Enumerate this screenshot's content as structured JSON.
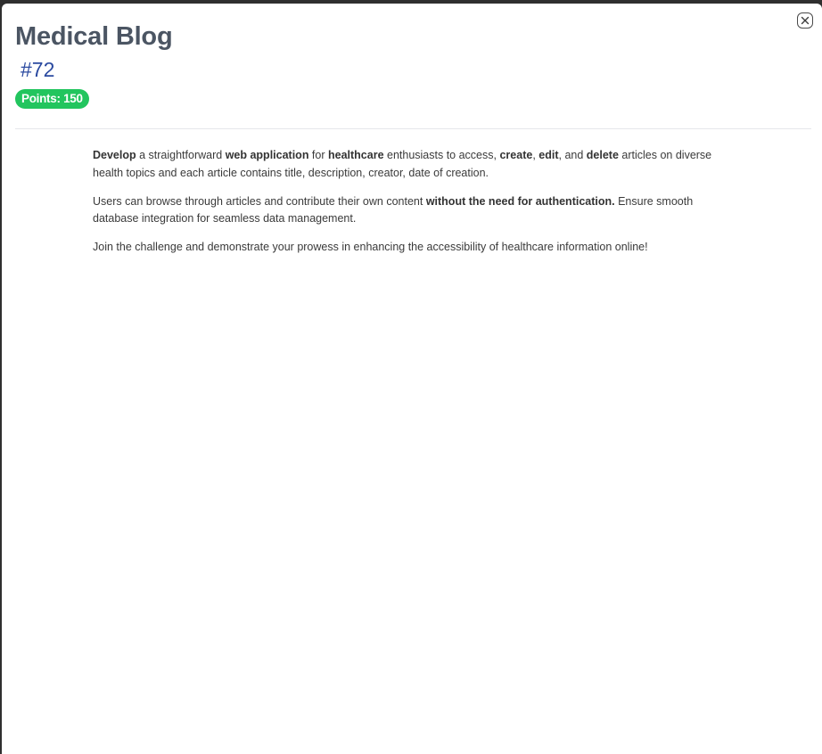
{
  "modal": {
    "title": "Medical Blog",
    "number": "#72",
    "points_badge": "Points: 150",
    "close_icon": "close-icon"
  },
  "content": {
    "p1": [
      {
        "text": "Develop",
        "bold": true
      },
      {
        "text": " a straightforward ",
        "bold": false
      },
      {
        "text": "web application",
        "bold": true
      },
      {
        "text": " for ",
        "bold": false
      },
      {
        "text": "healthcare",
        "bold": true
      },
      {
        "text": " enthusiasts to access, ",
        "bold": false
      },
      {
        "text": "create",
        "bold": true
      },
      {
        "text": ", ",
        "bold": false
      },
      {
        "text": "edit",
        "bold": true
      },
      {
        "text": ", and ",
        "bold": false
      },
      {
        "text": "delete",
        "bold": true
      },
      {
        "text": " articles on diverse health topics and each article contains title, description, creator, date of creation.",
        "bold": false
      }
    ],
    "p2": [
      {
        "text": "Users can browse through articles and contribute their own content ",
        "bold": false
      },
      {
        "text": "without the need for authentication.",
        "bold": true
      },
      {
        "text": " Ensure smooth database integration for seamless data management.",
        "bold": false
      }
    ],
    "p3": [
      {
        "text": "Join the challenge and demonstrate your prowess in enhancing the accessibility of healthcare information online!",
        "bold": false
      }
    ]
  },
  "colors": {
    "title": "#4b5563",
    "number": "#2b4aa0",
    "badge": "#22c55e"
  }
}
